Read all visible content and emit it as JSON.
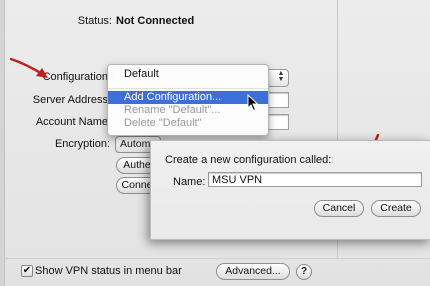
{
  "status": {
    "label": "Status:",
    "value": "Not Connected"
  },
  "form": {
    "configuration_label": "Configuration",
    "server_label": "Server Address",
    "account_label": "Account Name",
    "encryption_label": "Encryption:",
    "encryption_value": "Autom",
    "auth_button": "Authe",
    "connect_button": "Conne"
  },
  "menu": {
    "items": [
      {
        "label": "Default",
        "state": "normal"
      },
      {
        "label": "Add Configuration...",
        "state": "selected"
      },
      {
        "label": "Rename \"Default\"...",
        "state": "disabled"
      },
      {
        "label": "Delete \"Default\"",
        "state": "disabled"
      }
    ]
  },
  "sheet": {
    "prompt": "Create a new configuration called:",
    "name_label": "Name:",
    "name_value": "MSU VPN",
    "cancel_label": "Cancel",
    "create_label": "Create"
  },
  "footer": {
    "show_status_label": "Show VPN status in menu bar",
    "show_status_checked": true,
    "advanced_label": "Advanced...",
    "help_label": "?"
  },
  "colors": {
    "annotation_arrow": "#c0201e",
    "menu_highlight": "#3d6fd8"
  }
}
